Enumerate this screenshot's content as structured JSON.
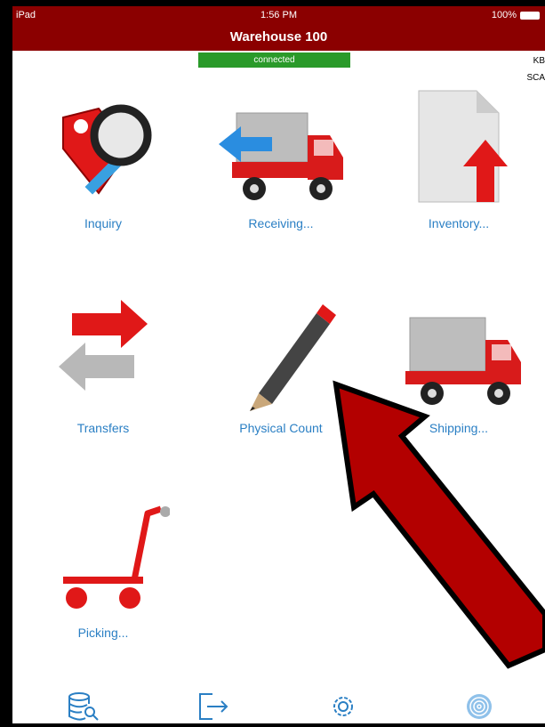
{
  "status_bar": {
    "device": "iPad",
    "time": "1:56 PM",
    "battery": "100%"
  },
  "nav": {
    "title": "Warehouse 100"
  },
  "connection": {
    "status": "connected",
    "color": "#2a9a2a"
  },
  "side_labels": {
    "kb": "KB",
    "sca": "SCA"
  },
  "tiles": [
    {
      "label": "Inquiry",
      "icon": "inquiry-icon"
    },
    {
      "label": "Receiving...",
      "icon": "receiving-truck-icon"
    },
    {
      "label": "Inventory...",
      "icon": "inventory-document-icon"
    },
    {
      "label": "Transfers",
      "icon": "transfers-arrows-icon"
    },
    {
      "label": "Physical Count",
      "icon": "pencil-icon"
    },
    {
      "label": "Shipping...",
      "icon": "shipping-truck-icon"
    },
    {
      "label": "Picking...",
      "icon": "cart-icon"
    }
  ],
  "toolbar": {
    "items": [
      "database-search-icon",
      "logout-icon",
      "settings-gear-icon",
      "fingerprint-icon"
    ]
  },
  "colors": {
    "brand": "#8b0000",
    "link": "#2a7fc4",
    "annotation_arrow": "#b30000"
  }
}
